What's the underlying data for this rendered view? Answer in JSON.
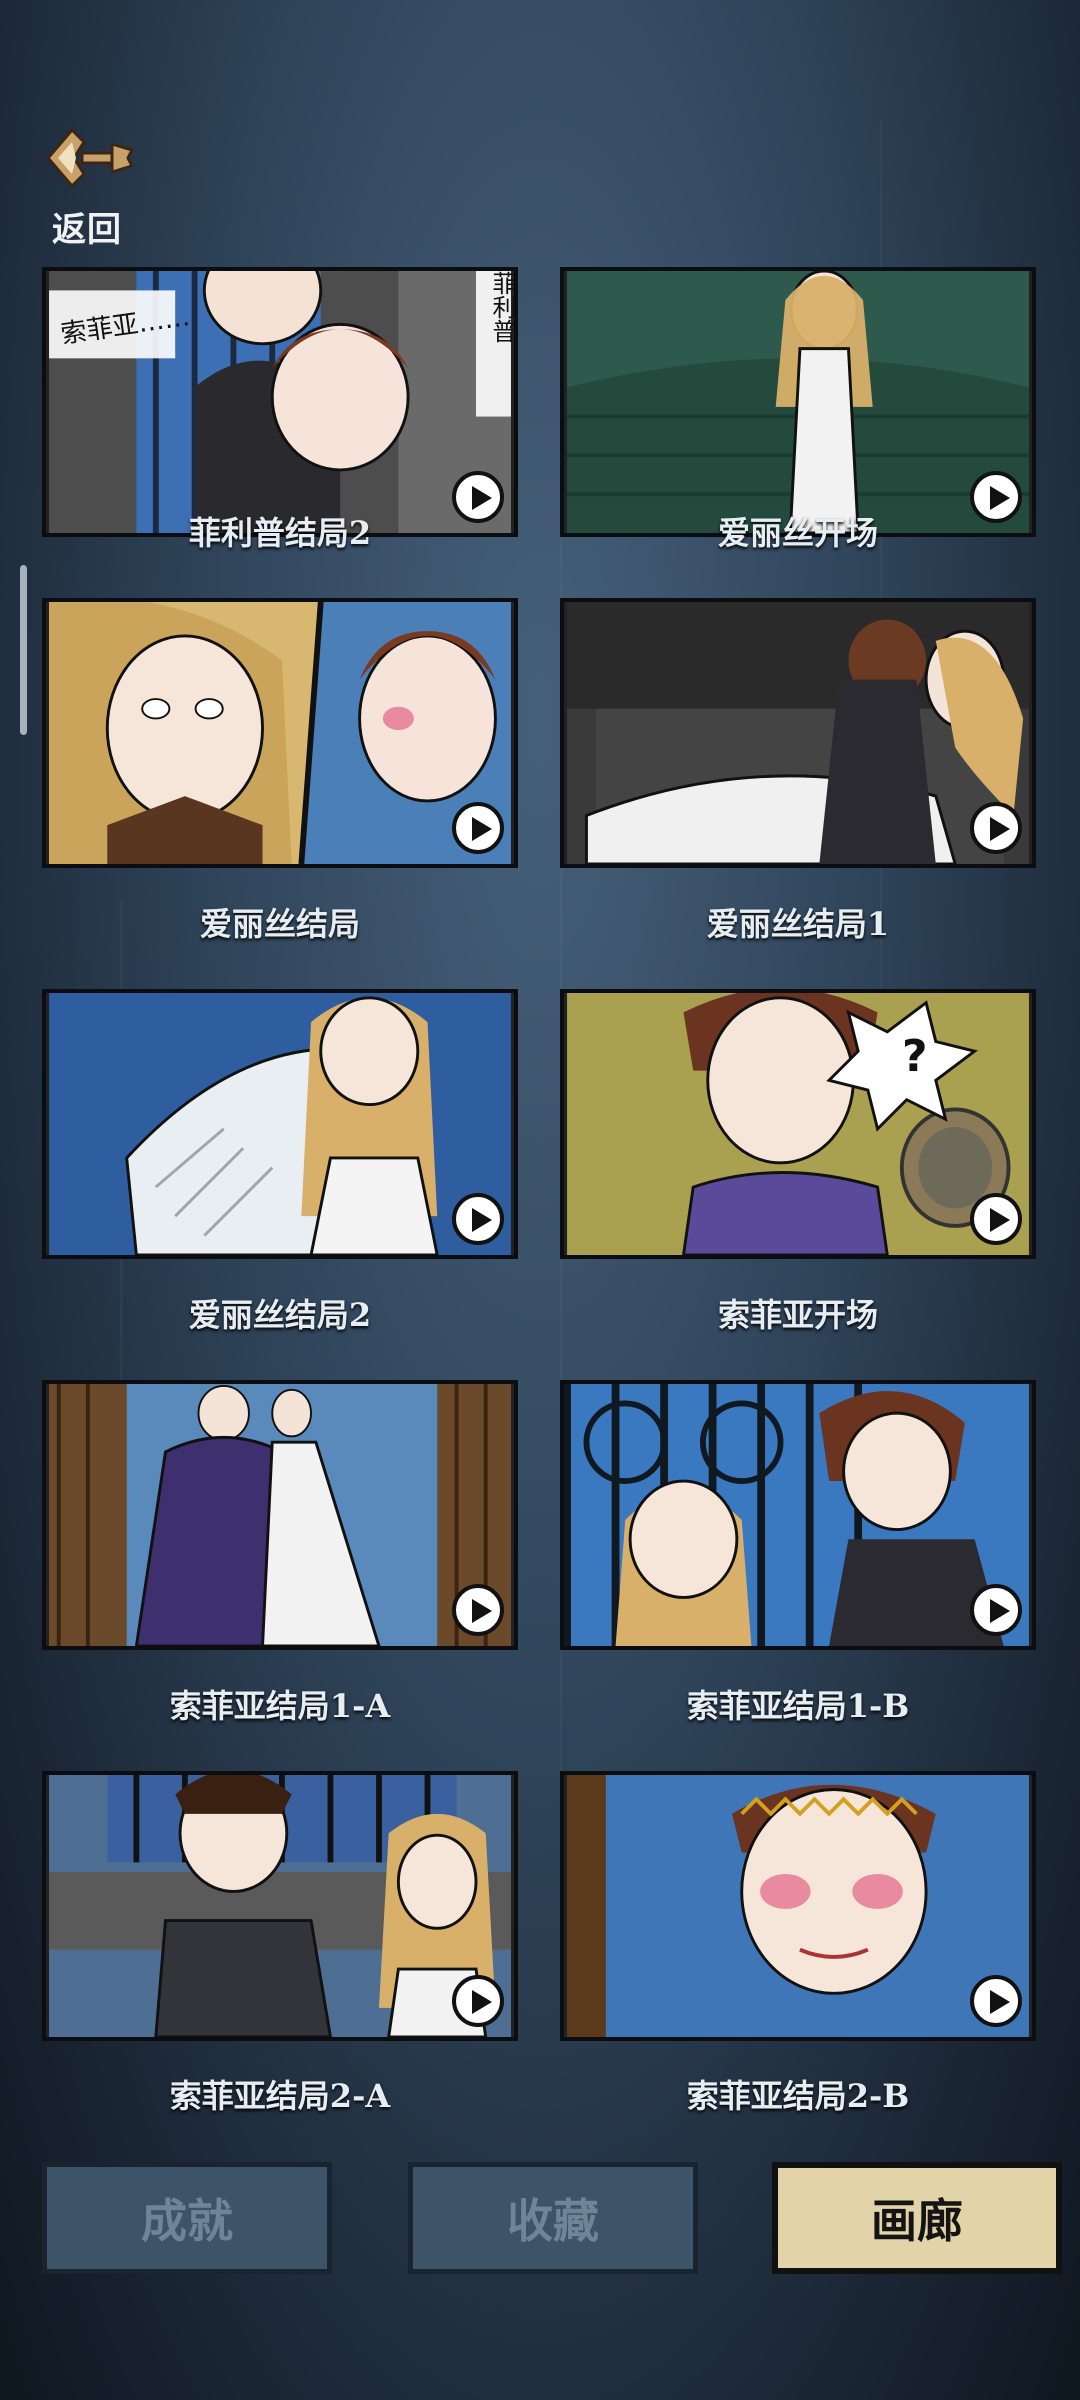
{
  "header": {
    "back_label": "返回",
    "back_icon": "key-arrow-icon"
  },
  "gallery": {
    "items": [
      {
        "title": "菲利普结局2",
        "bubble1": "索菲亚……",
        "bubble2": "菲利普",
        "accent": "#3c6fb4"
      },
      {
        "title": "爱丽丝开场",
        "accent": "#2d5a4c"
      },
      {
        "title": "爱丽丝结局",
        "accent": "#4a7fb8"
      },
      {
        "title": "爱丽丝结局1",
        "accent": "#3a3a3a"
      },
      {
        "title": "爱丽丝结局2",
        "accent": "#2f5ea0"
      },
      {
        "title": "索菲亚开场",
        "bubble": "?",
        "accent": "#a9a050"
      },
      {
        "title": "索菲亚结局1-A",
        "accent": "#5a89bc"
      },
      {
        "title": "索菲亚结局1-B",
        "accent": "#3a78c0"
      },
      {
        "title": "索菲亚结局2-A",
        "accent": "#4e6f93"
      },
      {
        "title": "索菲亚结局2-B",
        "accent": "#3f76b8"
      }
    ]
  },
  "tabs": {
    "achievements": "成就",
    "collection": "收藏",
    "gallery": "画廊"
  },
  "colors": {
    "tab_active_bg": "#e2d4a8",
    "tab_inactive_bg": "#3d5468"
  }
}
